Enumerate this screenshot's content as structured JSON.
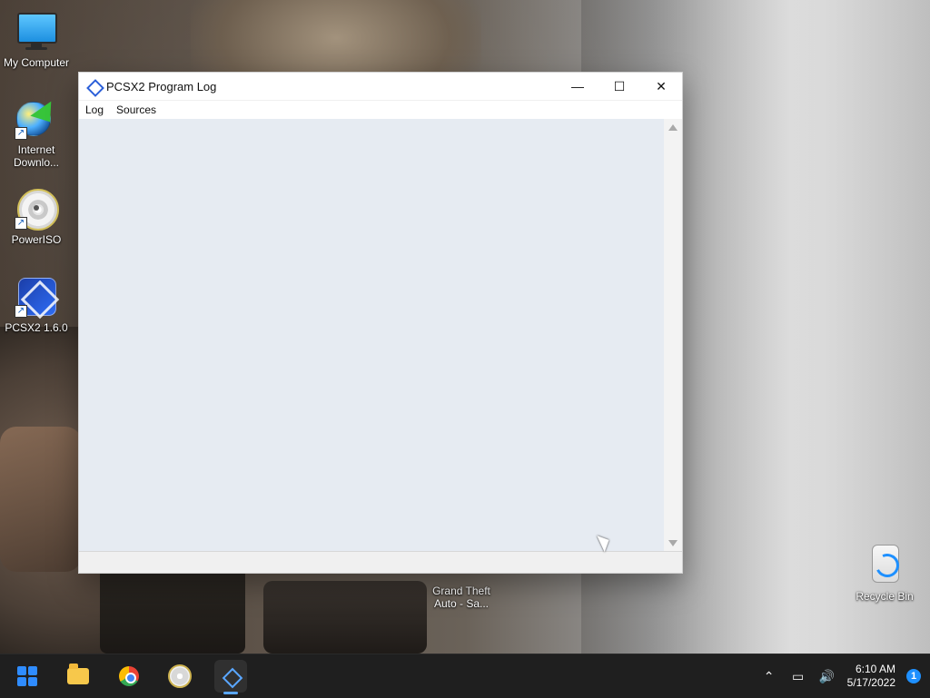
{
  "desktop": {
    "icons": [
      {
        "label": "My Computer"
      },
      {
        "label": "Internet Downlo..."
      },
      {
        "label": "PowerISO"
      },
      {
        "label": "PCSX2 1.6.0"
      },
      {
        "label": "Grand Theft Auto - Sa..."
      },
      {
        "label": "Recycle Bin"
      }
    ]
  },
  "window": {
    "title": "PCSX2 Program Log",
    "controls": {
      "minimize": "—",
      "maximize": "☐",
      "close": "✕"
    },
    "menu": [
      "Log",
      "Sources"
    ]
  },
  "taskbar": {
    "time": "6:10 AM",
    "date": "5/17/2022",
    "notifications": "1"
  }
}
